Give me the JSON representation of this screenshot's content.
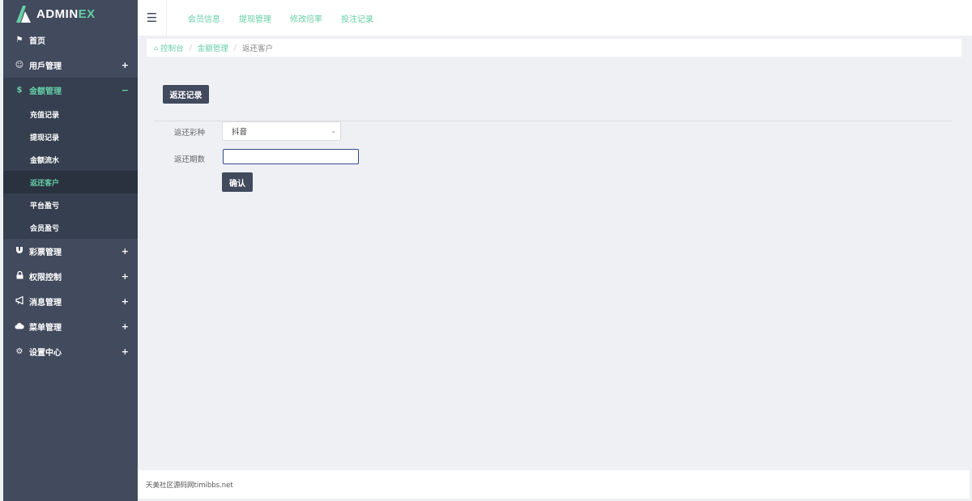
{
  "brand": {
    "prefix": "ADMIN",
    "suffix": "EX"
  },
  "sidebar": {
    "items": [
      {
        "label": "首页",
        "icon": "flag-icon",
        "sign": ""
      },
      {
        "label": "用戶管理",
        "icon": "smile-icon",
        "sign": "+"
      },
      {
        "label": "金额管理",
        "icon": "dollar-icon",
        "sign": "−",
        "active": true
      },
      {
        "label": "彩票管理",
        "icon": "magnet-icon",
        "sign": "+"
      },
      {
        "label": "权限控制",
        "icon": "lock-icon",
        "sign": "+"
      },
      {
        "label": "消息管理",
        "icon": "bullhorn-icon",
        "sign": "+"
      },
      {
        "label": "菜单管理",
        "icon": "cloud-icon",
        "sign": "+"
      },
      {
        "label": "设置中心",
        "icon": "gear-icon",
        "sign": "+"
      }
    ],
    "sub_items": [
      "充值记录",
      "提现记录",
      "金额流水",
      "返还客户",
      "平台盈亏",
      "会员盈亏"
    ],
    "active_sub": "返还客户"
  },
  "header": {
    "menu_icon": "hamburger-icon",
    "nav": [
      "会员信息",
      "提现管理",
      "修改倍率",
      "投注记录"
    ]
  },
  "breadcrumb": {
    "home": "控制台",
    "section": "金额管理",
    "current": "返还客户"
  },
  "main": {
    "records_button": "返还记录",
    "form": {
      "lottery_label": "返还彩种",
      "lottery_selected": "抖音",
      "period_label": "返还期数",
      "period_value": "",
      "confirm_label": "确认"
    }
  },
  "footer": {
    "text": "天美社区源码网timibbs.net"
  },
  "colors": {
    "accent": "#65cea7",
    "sidebar": "#424a5d",
    "sidebar_dark": "#353f4f"
  }
}
